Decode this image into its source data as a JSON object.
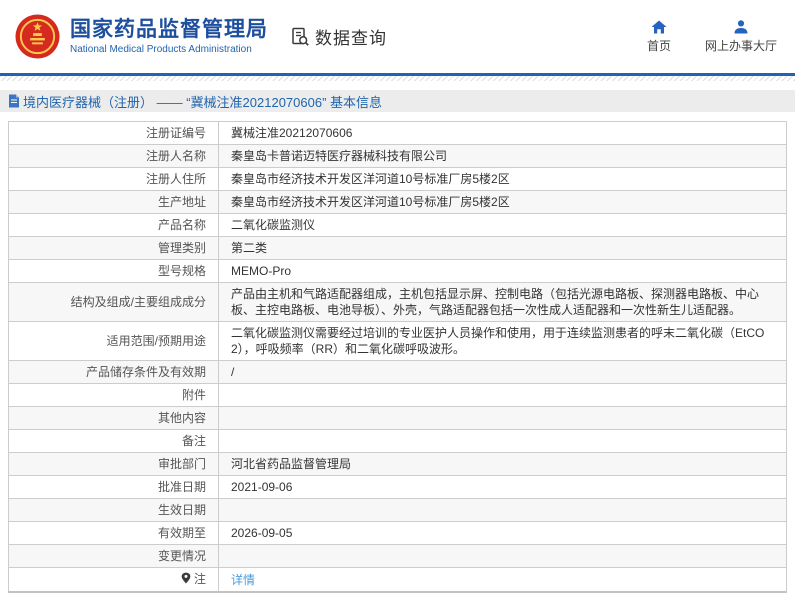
{
  "header": {
    "org_name_cn": "国家药品监督管理局",
    "org_name_en": "National Medical Products Administration",
    "section_title": "数据查询",
    "nav": [
      {
        "label": "首页",
        "icon": "home-icon"
      },
      {
        "label": "网上办事大厅",
        "icon": "person-icon"
      }
    ]
  },
  "breadcrumb": {
    "text": "境内医疗器械（注册） —— “冀械注准20212070606” 基本信息"
  },
  "table": {
    "rows": [
      {
        "label": "注册证编号",
        "value": "冀械注准20212070606"
      },
      {
        "label": "注册人名称",
        "value": "秦皇岛卡普诺迈特医疗器械科技有限公司"
      },
      {
        "label": "注册人住所",
        "value": "秦皇岛市经济技术开发区洋河道10号标准厂房5楼2区"
      },
      {
        "label": "生产地址",
        "value": "秦皇岛市经济技术开发区洋河道10号标准厂房5楼2区"
      },
      {
        "label": "产品名称",
        "value": "二氧化碳监测仪"
      },
      {
        "label": "管理类别",
        "value": "第二类"
      },
      {
        "label": "型号规格",
        "value": "MEMO-Pro"
      },
      {
        "label": "结构及组成/主要组成成分",
        "value": "产品由主机和气路适配器组成，主机包括显示屏、控制电路（包括光源电路板、探测器电路板、中心板、主控电路板、电池导板）、外壳，气路适配器包括一次性成人适配器和一次性新生儿适配器。"
      },
      {
        "label": "适用范围/预期用途",
        "value": "二氧化碳监测仪需要经过培训的专业医护人员操作和使用，用于连续监测患者的呼末二氧化碳（EtCO2），呼吸频率（RR）和二氧化碳呼吸波形。"
      },
      {
        "label": "产品储存条件及有效期",
        "value": "/"
      },
      {
        "label": "附件",
        "value": ""
      },
      {
        "label": "其他内容",
        "value": ""
      },
      {
        "label": "备注",
        "value": ""
      },
      {
        "label": "审批部门",
        "value": "河北省药品监督管理局"
      },
      {
        "label": "批准日期",
        "value": "2021-09-06"
      },
      {
        "label": "生效日期",
        "value": ""
      },
      {
        "label": "有效期至",
        "value": "2026-09-05"
      },
      {
        "label": "变更情况",
        "value": ""
      },
      {
        "label": "注",
        "value": "详情",
        "value_type": "link",
        "label_icon": "note-pin-icon"
      }
    ]
  },
  "colors": {
    "brand_blue": "#1d4f9e",
    "accent_blue": "#2062b4",
    "icon_blue": "#2563c0",
    "breadcrumb_text": "#1f64ad",
    "breadcrumb_bg": "#ececec",
    "table_border": "#cccccc",
    "row_alt_bg": "#f7f7f7",
    "label_text": "#555555",
    "value_text": "#333333",
    "link_blue": "#4a9bdc"
  }
}
